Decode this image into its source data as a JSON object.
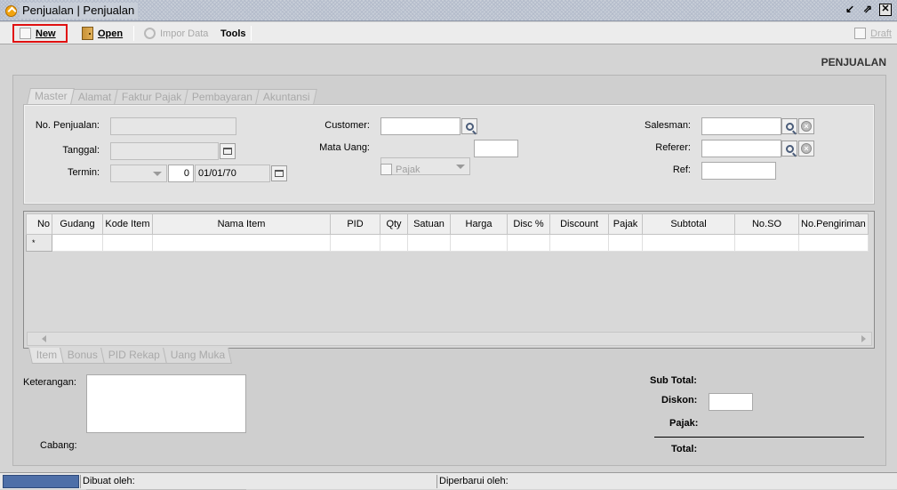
{
  "window": {
    "title": "Penjualan | Penjualan"
  },
  "toolbar": {
    "new_label": "New",
    "open_label": "Open",
    "impor_label": "Impor Data",
    "tools_label": "Tools",
    "draft_label": "Draft"
  },
  "page": {
    "heading": "PENJUALAN"
  },
  "tabs_top": [
    "Master",
    "Alamat",
    "Faktur Pajak",
    "Pembayaran",
    "Akuntansi"
  ],
  "form": {
    "no_penjualan_label": "No. Penjualan:",
    "tanggal_label": "Tanggal:",
    "termin_label": "Termin:",
    "termin_days": "0",
    "termin_date": "01/01/70",
    "customer_label": "Customer:",
    "mata_uang_label": "Mata Uang:",
    "pajak_label": "Pajak",
    "salesman_label": "Salesman:",
    "referer_label": "Referer:",
    "ref_label": "Ref:"
  },
  "grid": {
    "columns": [
      "No",
      "Gudang",
      "Kode Item",
      "Nama Item",
      "PID",
      "Qty",
      "Satuan",
      "Harga",
      "Disc %",
      "Discount",
      "Pajak",
      "Subtotal",
      "No.SO",
      "No.Pengiriman"
    ],
    "new_row_marker": "*"
  },
  "tabs_bottom": [
    "Item",
    "Bonus",
    "PID Rekap",
    "Uang Muka"
  ],
  "bottom": {
    "keterangan_label": "Keterangan:",
    "cabang_label": "Cabang:",
    "sub_total_label": "Sub Total:",
    "diskon_label": "Diskon:",
    "pajak_label": "Pajak:",
    "total_label": "Total:"
  },
  "status": {
    "dibuat_label": "Dibuat oleh:",
    "diperbarui_label": "Diperbarui oleh:"
  }
}
